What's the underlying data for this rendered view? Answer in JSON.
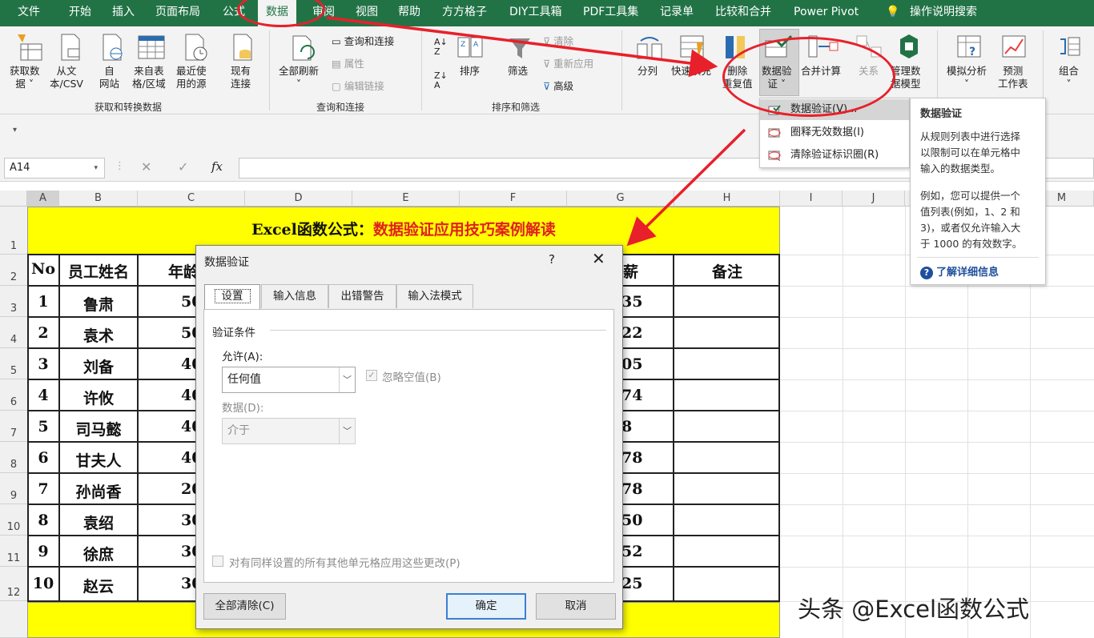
{
  "menu": {
    "tabs": [
      "文件",
      "开始",
      "插入",
      "页面布局",
      "公式",
      "数据",
      "审阅",
      "视图",
      "帮助",
      "方方格子",
      "DIY工具箱",
      "PDF工具集",
      "记录单",
      "比较和合并",
      "Power Pivot"
    ],
    "active_tab": "数据",
    "tell_me": "操作说明搜索"
  },
  "ribbon": {
    "get_data": "获取数",
    "get_data2": "据",
    "from_text": "从文",
    "from_text2": "本/CSV",
    "from_web": "自",
    "from_web2": "网站",
    "from_table": "来自表",
    "from_table2": "格/区域",
    "recent_sources": "最近使",
    "recent_sources2": "用的源",
    "existing": "现有",
    "existing2": "连接",
    "group_get": "获取和转换数据",
    "refresh_all": "全部刷新",
    "queries_connections": "查询和连接",
    "properties": "属性",
    "edit_links": "编辑链接",
    "group_queries": "查询和连接",
    "sort": "排序",
    "filter": "筛选",
    "clear": "清除",
    "reapply": "重新应用",
    "advanced": "高级",
    "group_sort": "排序和筛选",
    "split": "分列",
    "flash_fill": "快速填充",
    "remove_dup": "删除",
    "remove_dup2": "重复值",
    "data_validation": "数据验",
    "data_validation2": "证",
    "consolidate": "合并计算",
    "relationships": "关系",
    "manage_model": "管理数",
    "manage_model2": "据模型",
    "what_if": "模拟分析",
    "forecast": "预测",
    "forecast2": "工作表",
    "group_btn": "组合"
  },
  "namebox": "A14",
  "fx": "fx",
  "columns": [
    "A",
    "B",
    "C",
    "D",
    "E",
    "F",
    "G",
    "H",
    "I",
    "J",
    "K",
    "L",
    "M"
  ],
  "rows": [
    "1",
    "2",
    "3",
    "4",
    "5",
    "6",
    "7",
    "8",
    "9",
    "10",
    "11",
    "12"
  ],
  "sheet": {
    "title_black": "Excel函数公式：",
    "title_red": "数据验证应用技巧案例解读",
    "header": {
      "no": "No",
      "name": "员工姓名",
      "age": "年龄",
      "salary": "薪",
      "note": "备注"
    },
    "records": [
      {
        "no": "1",
        "name": "鲁肃",
        "age": "50",
        "sal": "35"
      },
      {
        "no": "2",
        "name": "袁术",
        "age": "50",
        "sal": "22"
      },
      {
        "no": "3",
        "name": "刘备",
        "age": "40",
        "sal": "05"
      },
      {
        "no": "4",
        "name": "许攸",
        "age": "40",
        "sal": "74"
      },
      {
        "no": "5",
        "name": "司马懿",
        "age": "40",
        "sal": "8"
      },
      {
        "no": "6",
        "name": "甘夫人",
        "age": "40",
        "sal": "78"
      },
      {
        "no": "7",
        "name": "孙尚香",
        "age": "20",
        "sal": "78"
      },
      {
        "no": "8",
        "name": "袁绍",
        "age": "30",
        "sal": "50"
      },
      {
        "no": "9",
        "name": "徐庶",
        "age": "30",
        "sal": "52"
      },
      {
        "no": "10",
        "name": "赵云",
        "age": "30",
        "sal": "25"
      }
    ]
  },
  "dropdown": {
    "items": [
      "数据验证(V)...",
      "圈释无效数据(I)",
      "清除验证标识圈(R)"
    ]
  },
  "tooltip": {
    "title": "数据验证",
    "line1": "从规则列表中进行选择",
    "line2": "以限制可以在单元格中",
    "line3": "输入的数据类型。",
    "line4": "例如，您可以提供一个",
    "line5": "值列表(例如，1、2 和",
    "line6": "3)，或者仅允许输入大",
    "line7": "于 1000 的有效数字。",
    "link": "了解详细信息"
  },
  "dialog": {
    "title": "数据验证",
    "help": "?",
    "close": "✕",
    "tabs": [
      "设置",
      "输入信息",
      "出错警告",
      "输入法模式"
    ],
    "section": "验证条件",
    "allow_label": "允许(A):",
    "allow_value": "任何值",
    "ignore_blank": "忽略空值(B)",
    "data_label": "数据(D):",
    "data_value": "介于",
    "apply_all": "对有同样设置的所有其他单元格应用这些更改(P)",
    "clear_all": "全部清除(C)",
    "ok": "确定",
    "cancel": "取消"
  },
  "watermark": "头条 @Excel函数公式",
  "colors": {
    "excel_green": "#217346",
    "highlight_yellow": "#ffff00",
    "annotation_red": "#e8202a"
  }
}
